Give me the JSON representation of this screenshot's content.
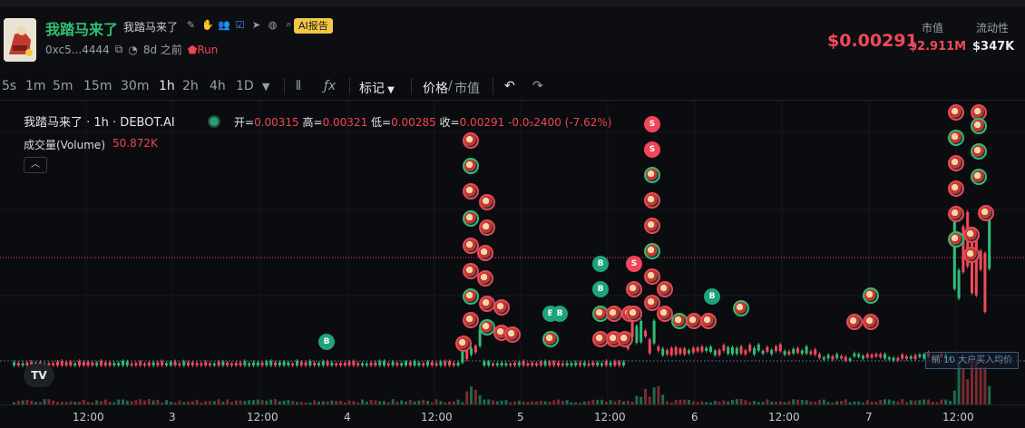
{
  "header": {
    "title": "我踏马来了",
    "subtitle": "我踏马来了",
    "ai_badge": "AI报告",
    "address": "0xc5...4444",
    "age": "8d 之前",
    "run_label": "Run",
    "price": "$0.00291",
    "market_cap_label": "市值",
    "market_cap": "$2.911M",
    "liquidity_label": "流动性",
    "liquidity": "$347K"
  },
  "toolbar": {
    "intervals": [
      "5s",
      "1m",
      "5m",
      "15m",
      "30m",
      "1h",
      "2h",
      "4h",
      "1D"
    ],
    "active_interval": "1h",
    "marks_label": "标记",
    "price_label": "价格",
    "mcap_label": "市值",
    "separator": "/"
  },
  "legend": {
    "title": "我踏马来了 · 1h · DEBOT.AI",
    "open_label": "开=",
    "open": "0.00315",
    "high_label": "高=",
    "high": "0.00321",
    "low_label": "低=",
    "low": "0.00285",
    "close_label": "收=",
    "close": "0.00291",
    "change": "-0.0₅2400 (-7.62%)",
    "volume_label": "成交量(Volume)",
    "volume": "50.872K"
  },
  "avg_line_label": "前 10 大户买入均价",
  "tv_logo": "TV",
  "xaxis": {
    "labels": [
      "12:00",
      "3",
      "12:00",
      "4",
      "12:00",
      "5",
      "12:00",
      "6",
      "12:00",
      "7",
      "12:00"
    ]
  },
  "colors": {
    "up": "#2dbd7a",
    "down": "#f04a5b",
    "accent": "#f2c744",
    "bg": "#0b0c0f"
  },
  "icons": {
    "edit": "pencil-icon",
    "copy": "copy-icon",
    "telegram": "telegram-icon",
    "web": "globe-icon",
    "search": "search-icon"
  }
}
